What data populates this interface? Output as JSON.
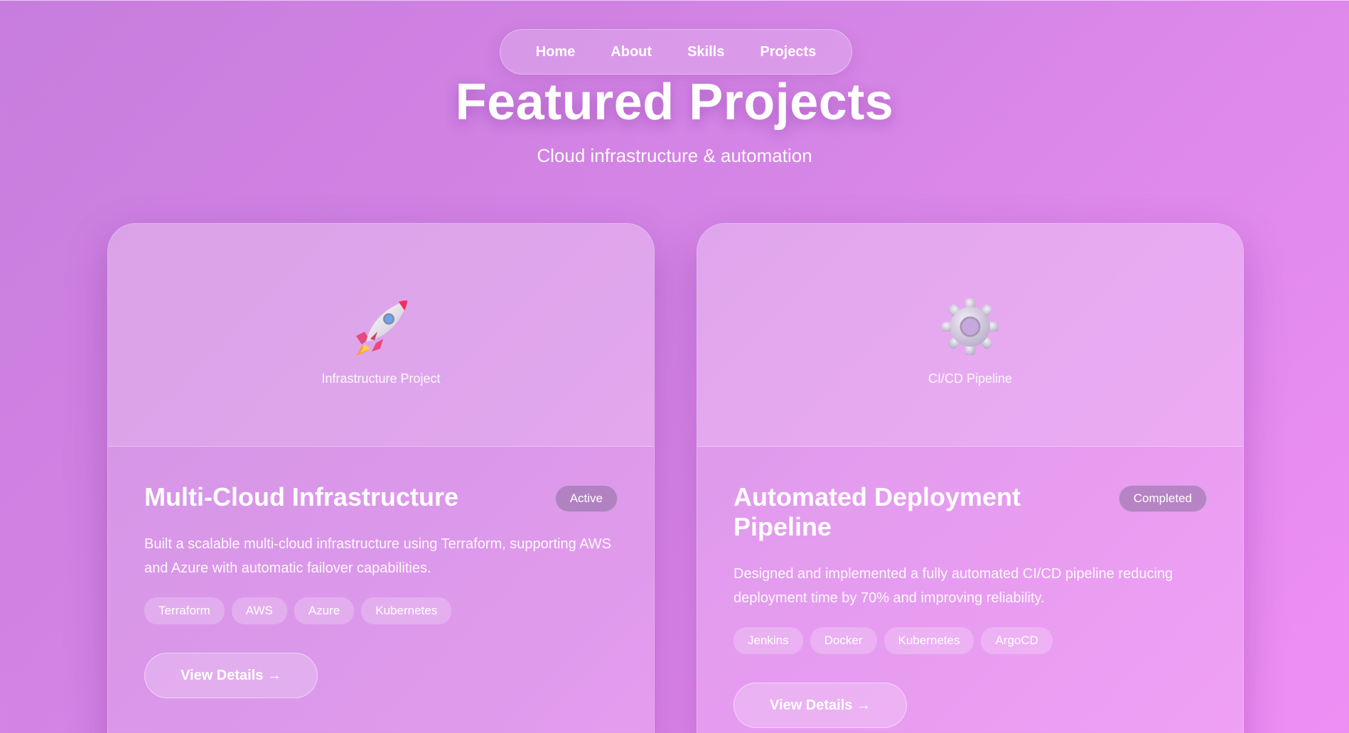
{
  "nav": {
    "items": [
      "Home",
      "About",
      "Skills",
      "Projects"
    ]
  },
  "header": {
    "title": "Featured Projects",
    "subtitle": "Cloud infrastructure & automation"
  },
  "projects": [
    {
      "icon": "rocket-icon",
      "caption": "Infrastructure Project",
      "title": "Multi-Cloud Infrastructure",
      "status": "Active",
      "description": "Built a scalable multi-cloud infrastructure using Terraform, supporting AWS and Azure with automatic failover capabilities.",
      "tags": [
        "Terraform",
        "AWS",
        "Azure",
        "Kubernetes"
      ],
      "button": "View Details →"
    },
    {
      "icon": "gear-icon",
      "caption": "CI/CD Pipeline",
      "title": "Automated Deployment Pipeline",
      "status": "Completed",
      "description": "Designed and implemented a fully automated CI/CD pipeline reducing deployment time by 70% and improving reliability.",
      "tags": [
        "Jenkins",
        "Docker",
        "Kubernetes",
        "ArgoCD"
      ],
      "button": "View Details →"
    }
  ]
}
